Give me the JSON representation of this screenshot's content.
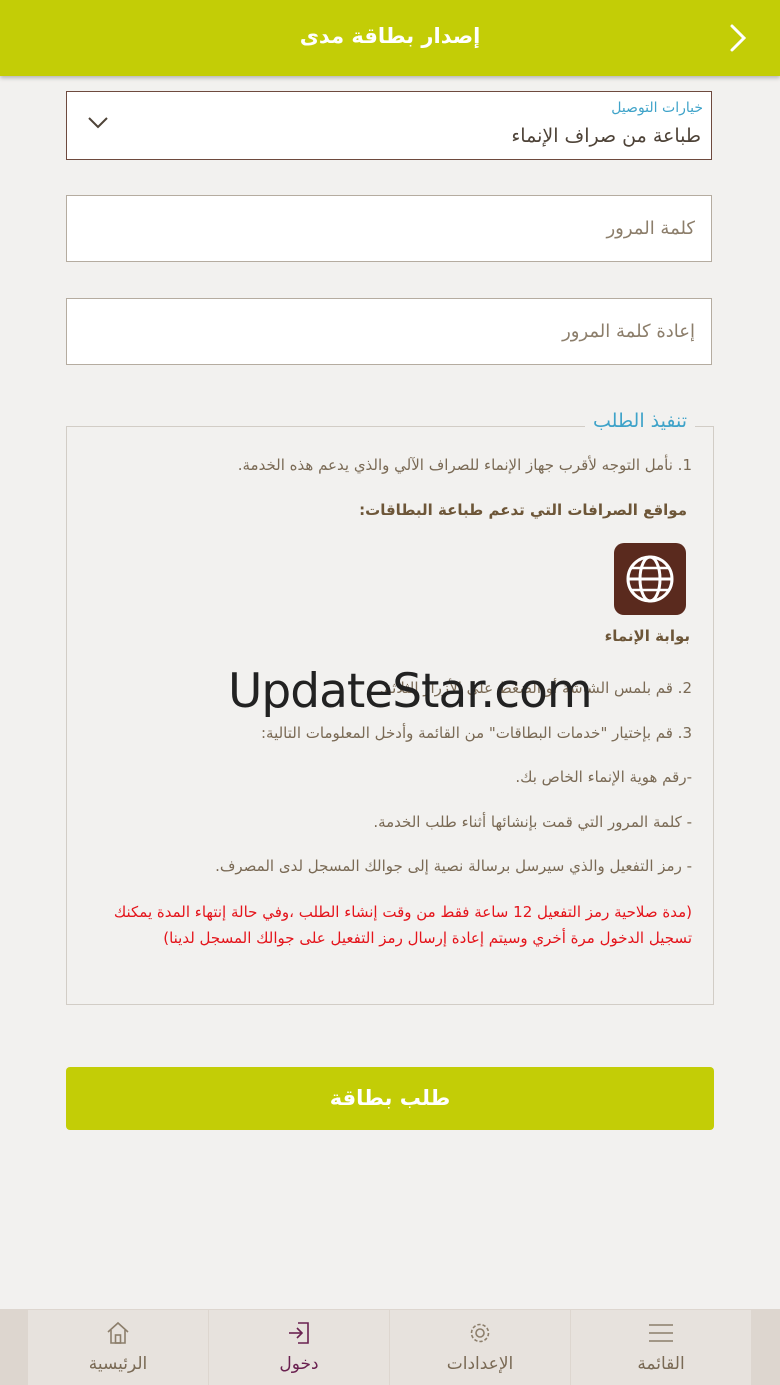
{
  "header": {
    "title": "إصدار بطاقة مدى",
    "back_icon": "chevron-right-icon"
  },
  "form": {
    "delivery": {
      "label": "خيارات التوصيل",
      "value": "طباعة من صراف الإنماء"
    },
    "password": {
      "placeholder": "كلمة المرور"
    },
    "confirm_password": {
      "placeholder": "إعادة كلمة المرور"
    }
  },
  "instructions": {
    "legend": "تنفيذ الطلب",
    "step1": "1. نأمل التوجه لأقرب جهاز الإنماء للصراف الآلي والذي يدعم هذه الخدمة.",
    "atm_locations_heading": "مواقع الصرافات التي تدعم طباعة البطاقات:",
    "portal_label": "بوابة الإنماء",
    "step2": "2. قم بلمس الشاشة أو الضغط على الأزرار الثلاثة.",
    "step3": "3. قم بإختيار \"خدمات البطاقات\" من القائمة وأدخل المعلومات التالية:",
    "item_id": "-رقم هوية الإنماء الخاص بك.",
    "item_password": "- كلمة المرور التي قمت بإنشائها أثناء طلب الخدمة.",
    "item_code": "- رمز التفعيل والذي سيرسل برسالة نصية إلى جوالك المسجل لدى المصرف.",
    "note": "(مدة صلاحية رمز التفعيل 12 ساعة فقط من وقت إنشاء الطلب ،وفي حالة إنتهاء المدة يمكنك تسجيل الدخول مرة أخري وسيتم إعادة إرسال رمز التفعيل على جوالك المسجل لدينا)"
  },
  "watermark": "UpdateStar.com",
  "submit_label": "طلب بطاقة",
  "bottom_nav": {
    "home": "الرئيسية",
    "login": "دخول",
    "settings": "الإعدادات",
    "menu": "القائمة"
  },
  "colors": {
    "accent": "#c3cd06",
    "link": "#3fa3c9",
    "warning": "#e4141b",
    "active_nav": "#6a2150"
  }
}
